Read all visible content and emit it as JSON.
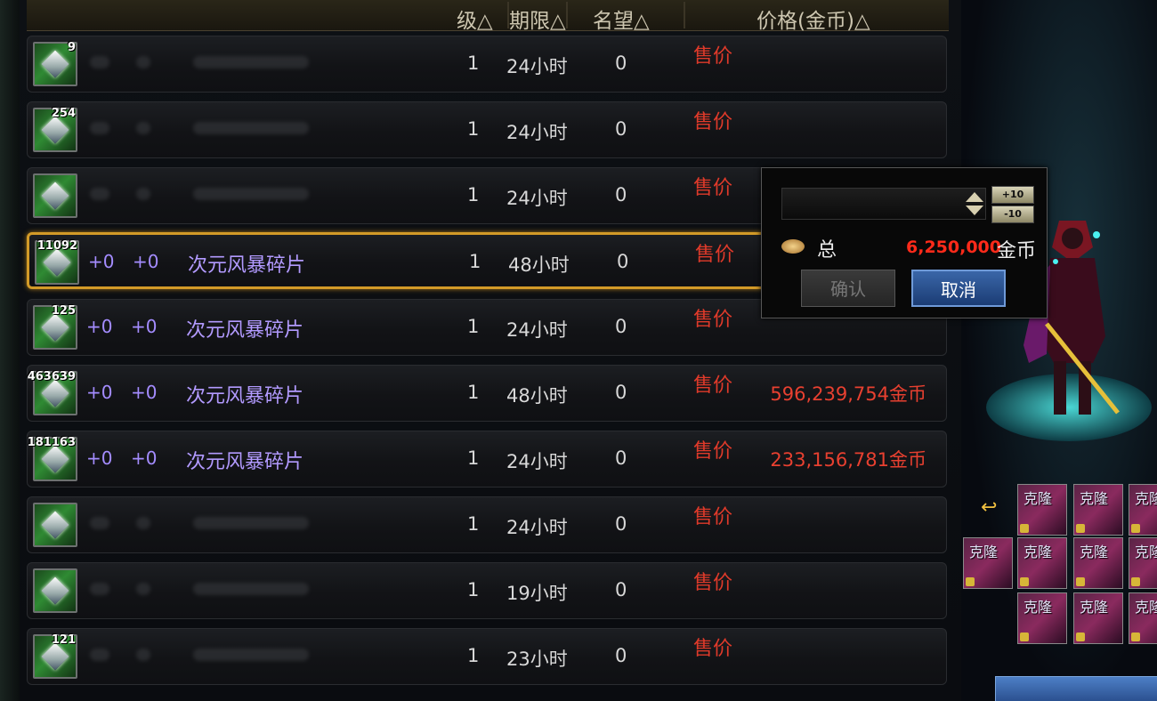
{
  "header": {
    "level_col": "级△",
    "duration_col": "期限△",
    "fame_col": "名望△",
    "price_col": "价格(金币)△"
  },
  "rows": [
    {
      "qty": "9",
      "enhance1": "",
      "enhance2": "",
      "name": "",
      "level": "1",
      "duration": "24小时",
      "fame": "0",
      "sale_label": "售价",
      "price": "",
      "selected": false
    },
    {
      "qty": "254",
      "enhance1": "",
      "enhance2": "",
      "name": "",
      "level": "1",
      "duration": "24小时",
      "fame": "0",
      "sale_label": "售价",
      "price": "",
      "selected": false
    },
    {
      "qty": "",
      "enhance1": "",
      "enhance2": "",
      "name": "",
      "level": "1",
      "duration": "24小时",
      "fame": "0",
      "sale_label": "售价",
      "price": "",
      "selected": false
    },
    {
      "qty": "11092",
      "enhance1": "+0",
      "enhance2": "+0",
      "name": "次元风暴碎片",
      "level": "1",
      "duration": "48小时",
      "fame": "0",
      "sale_label": "售价",
      "price": "",
      "selected": true
    },
    {
      "qty": "125",
      "enhance1": "+0",
      "enhance2": "+0",
      "name": "次元风暴碎片",
      "level": "1",
      "duration": "24小时",
      "fame": "0",
      "sale_label": "售价",
      "price": "",
      "selected": false
    },
    {
      "qty": "463639",
      "enhance1": "+0",
      "enhance2": "+0",
      "name": "次元风暴碎片",
      "level": "1",
      "duration": "48小时",
      "fame": "0",
      "sale_label": "售价",
      "price": "596,239,754金币",
      "selected": false
    },
    {
      "qty": "181163",
      "enhance1": "+0",
      "enhance2": "+0",
      "name": "次元风暴碎片",
      "level": "1",
      "duration": "24小时",
      "fame": "0",
      "sale_label": "售价",
      "price": "233,156,781金币",
      "selected": false
    },
    {
      "qty": "",
      "enhance1": "",
      "enhance2": "",
      "name": "",
      "level": "1",
      "duration": "24小时",
      "fame": "0",
      "sale_label": "售价",
      "price": "",
      "selected": false
    },
    {
      "qty": "",
      "enhance1": "",
      "enhance2": "",
      "name": "",
      "level": "1",
      "duration": "19小时",
      "fame": "0",
      "sale_label": "售价",
      "price": "",
      "selected": false
    },
    {
      "qty": "121",
      "enhance1": "",
      "enhance2": "",
      "name": "",
      "level": "1",
      "duration": "23小时",
      "fame": "0",
      "sale_label": "售价",
      "price": "",
      "selected": false
    }
  ],
  "popup": {
    "plus_label": "+10",
    "minus_label": "-10",
    "total_label": "总",
    "total_value": "6,250,000",
    "total_unit": "金币",
    "confirm_label": "确认",
    "cancel_label": "取消"
  },
  "side": {
    "clone_label": "克隆",
    "icons": [
      "swap-icon",
      "lock-icon"
    ]
  },
  "colors": {
    "selected_border": "#d39a28",
    "sale_red": "#e03a2a",
    "item_purple": "#b29aff",
    "cancel_blue": "#2a52a0"
  }
}
